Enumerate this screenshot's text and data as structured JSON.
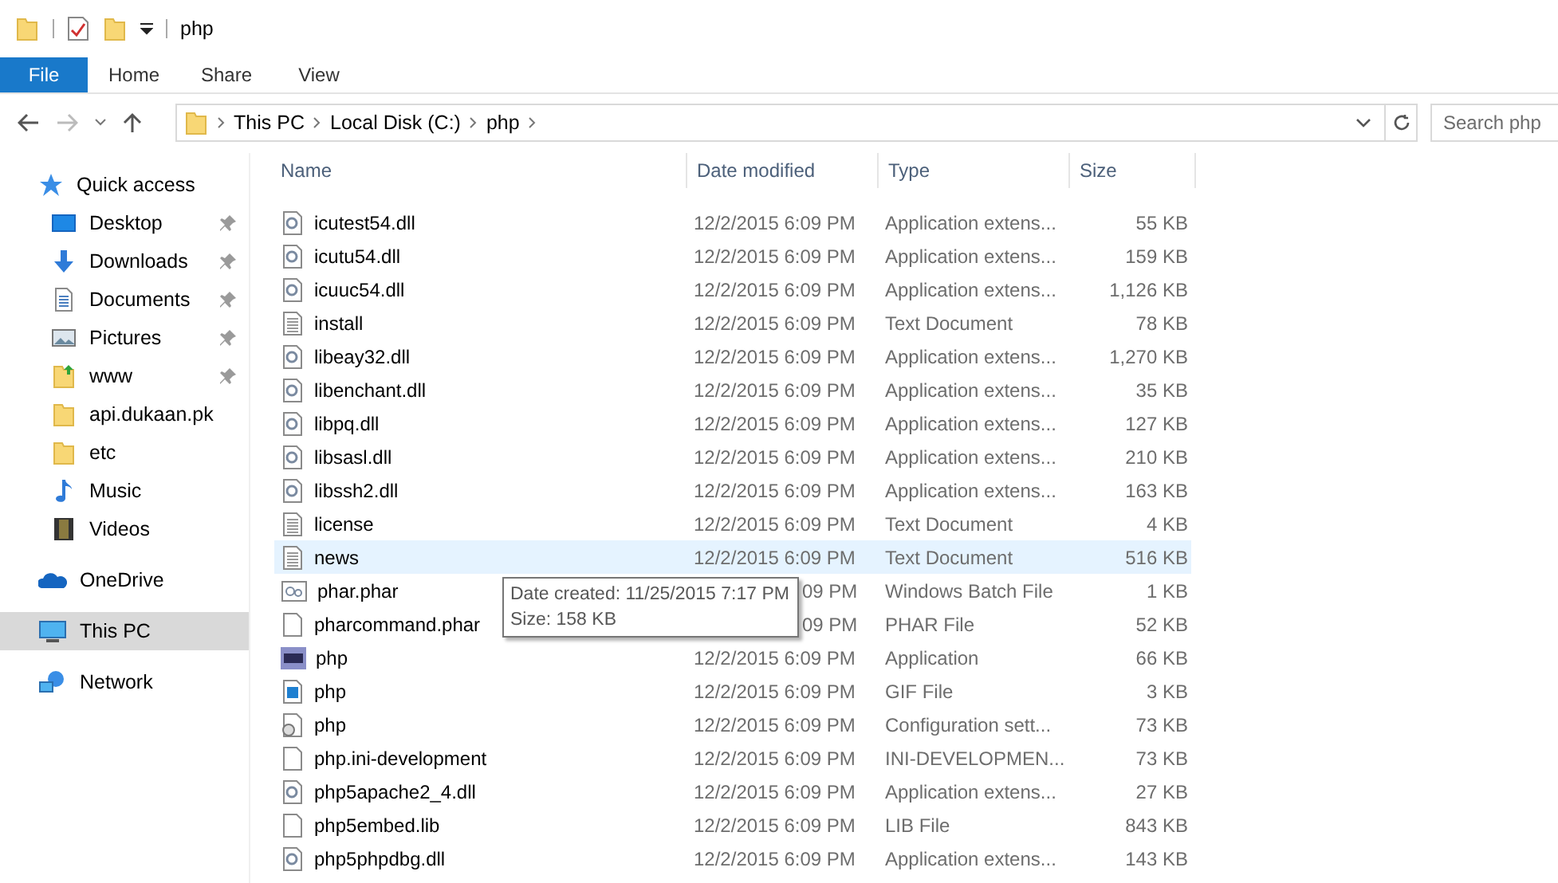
{
  "window": {
    "title": "php"
  },
  "ribbon_tabs": [
    {
      "label": "File",
      "selected": true
    },
    {
      "label": "Home",
      "selected": false
    },
    {
      "label": "Share",
      "selected": false
    },
    {
      "label": "View",
      "selected": false
    }
  ],
  "breadcrumb": [
    "This PC",
    "Local Disk (C:)",
    "php"
  ],
  "search": {
    "placeholder": "Search php"
  },
  "sidebar": {
    "items": [
      {
        "label": "Quick access",
        "kind": "star",
        "selected": false,
        "children": [
          {
            "label": "Desktop",
            "kind": "desktop",
            "pinned": true,
            "selected": false
          },
          {
            "label": "Downloads",
            "kind": "download",
            "pinned": true,
            "selected": false
          },
          {
            "label": "Documents",
            "kind": "documents",
            "pinned": true,
            "selected": false
          },
          {
            "label": "Pictures",
            "kind": "pictures",
            "pinned": true,
            "selected": false
          },
          {
            "label": "www",
            "kind": "folderup",
            "pinned": true,
            "selected": false
          },
          {
            "label": "api.dukaan.pk",
            "kind": "folder",
            "pinned": false,
            "selected": false
          },
          {
            "label": "etc",
            "kind": "folder",
            "pinned": false,
            "selected": false
          },
          {
            "label": "Music",
            "kind": "music",
            "pinned": false,
            "selected": false
          },
          {
            "label": "Videos",
            "kind": "videos",
            "pinned": false,
            "selected": false
          }
        ]
      },
      {
        "label": "OneDrive",
        "kind": "cloud",
        "selected": false
      },
      {
        "label": "This PC",
        "kind": "pc",
        "selected": true
      },
      {
        "label": "Network",
        "kind": "network",
        "selected": false
      }
    ]
  },
  "table": {
    "columns": [
      "Name",
      "Date modified",
      "Type",
      "Size"
    ],
    "rows": [
      {
        "kind": "dll",
        "name": "icutest54.dll",
        "date": "12/2/2015 6:09 PM",
        "date_covered": false,
        "type": "Application extens...",
        "size": "55 KB",
        "selected": false
      },
      {
        "kind": "dll",
        "name": "icutu54.dll",
        "date": "12/2/2015 6:09 PM",
        "date_covered": false,
        "type": "Application extens...",
        "size": "159 KB",
        "selected": false
      },
      {
        "kind": "dll",
        "name": "icuuc54.dll",
        "date": "12/2/2015 6:09 PM",
        "date_covered": false,
        "type": "Application extens...",
        "size": "1,126 KB",
        "selected": false
      },
      {
        "kind": "text",
        "name": "install",
        "date": "12/2/2015 6:09 PM",
        "date_covered": false,
        "type": "Text Document",
        "size": "78 KB",
        "selected": false
      },
      {
        "kind": "dll",
        "name": "libeay32.dll",
        "date": "12/2/2015 6:09 PM",
        "date_covered": false,
        "type": "Application extens...",
        "size": "1,270 KB",
        "selected": false
      },
      {
        "kind": "dll",
        "name": "libenchant.dll",
        "date": "12/2/2015 6:09 PM",
        "date_covered": false,
        "type": "Application extens...",
        "size": "35 KB",
        "selected": false
      },
      {
        "kind": "dll",
        "name": "libpq.dll",
        "date": "12/2/2015 6:09 PM",
        "date_covered": false,
        "type": "Application extens...",
        "size": "127 KB",
        "selected": false
      },
      {
        "kind": "dll",
        "name": "libsasl.dll",
        "date": "12/2/2015 6:09 PM",
        "date_covered": false,
        "type": "Application extens...",
        "size": "210 KB",
        "selected": false
      },
      {
        "kind": "dll",
        "name": "libssh2.dll",
        "date": "12/2/2015 6:09 PM",
        "date_covered": false,
        "type": "Application extens...",
        "size": "163 KB",
        "selected": false
      },
      {
        "kind": "text",
        "name": "license",
        "date": "12/2/2015 6:09 PM",
        "date_covered": false,
        "type": "Text Document",
        "size": "4 KB",
        "selected": false
      },
      {
        "kind": "text",
        "name": "news",
        "date": "12/2/2015 6:09 PM",
        "date_covered": false,
        "type": "Text Document",
        "size": "516 KB",
        "selected": true
      },
      {
        "kind": "batch",
        "name": "phar.phar",
        "date": "09 PM",
        "date_covered": true,
        "type": "Windows Batch File",
        "size": "1 KB",
        "selected": false
      },
      {
        "kind": "blank",
        "name": "pharcommand.phar",
        "date": "09 PM",
        "date_covered": true,
        "type": "PHAR File",
        "size": "52 KB",
        "selected": false
      },
      {
        "kind": "php",
        "name": "php",
        "date": "12/2/2015 6:09 PM",
        "date_covered": false,
        "type": "Application",
        "size": "66 KB",
        "selected": false
      },
      {
        "kind": "gif",
        "name": "php",
        "date": "12/2/2015 6:09 PM",
        "date_covered": false,
        "type": "GIF File",
        "size": "3 KB",
        "selected": false
      },
      {
        "kind": "config",
        "name": "php",
        "date": "12/2/2015 6:09 PM",
        "date_covered": false,
        "type": "Configuration sett...",
        "size": "73 KB",
        "selected": false
      },
      {
        "kind": "blank",
        "name": "php.ini-development",
        "date": "12/2/2015 6:09 PM",
        "date_covered": false,
        "type": "INI-DEVELOPMEN...",
        "size": "73 KB",
        "selected": false
      },
      {
        "kind": "dll",
        "name": "php5apache2_4.dll",
        "date": "12/2/2015 6:09 PM",
        "date_covered": false,
        "type": "Application extens...",
        "size": "27 KB",
        "selected": false
      },
      {
        "kind": "blank",
        "name": "php5embed.lib",
        "date": "12/2/2015 6:09 PM",
        "date_covered": false,
        "type": "LIB File",
        "size": "843 KB",
        "selected": false
      },
      {
        "kind": "dll",
        "name": "php5phpdbg.dll",
        "date": "12/2/2015 6:09 PM",
        "date_covered": false,
        "type": "Application extens...",
        "size": "143 KB",
        "selected": false
      }
    ]
  },
  "tooltip": {
    "lines": [
      "Date created: 11/25/2015 7:17 PM",
      "Size: 158 KB"
    ]
  }
}
